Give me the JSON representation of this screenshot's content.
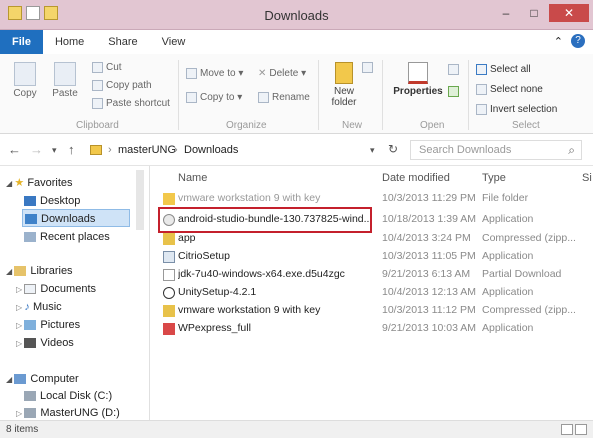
{
  "window": {
    "title": "Downloads",
    "controls": {
      "minimize": "–",
      "maximize": "□",
      "close": "✕"
    }
  },
  "ribbon_tabs": [
    "File",
    "Home",
    "Share",
    "View"
  ],
  "ribbon": {
    "clipboard": {
      "copy": "Copy",
      "paste": "Paste",
      "cut": "Cut",
      "copy_path": "Copy path",
      "paste_shortcut": "Paste shortcut",
      "group": "Clipboard"
    },
    "organize": {
      "move_to": "Move to ▾",
      "delete": "Delete ▾",
      "copy_to": "Copy to ▾",
      "rename": "Rename",
      "group": "Organize"
    },
    "new": {
      "new_folder": "New folder",
      "group": "New"
    },
    "open": {
      "properties": "Properties",
      "group": "Open"
    },
    "select": {
      "select_all": "Select all",
      "select_none": "Select none",
      "invert_selection": "Invert selection",
      "group": "Select"
    }
  },
  "address": {
    "crumbs": [
      "masterUNG",
      "Downloads"
    ],
    "search_placeholder": "Search Downloads"
  },
  "nav": {
    "favorites": "Favorites",
    "desktop": "Desktop",
    "downloads": "Downloads",
    "recent": "Recent places",
    "libraries": "Libraries",
    "documents": "Documents",
    "music": "Music",
    "pictures": "Pictures",
    "videos": "Videos",
    "computer": "Computer",
    "local_disk": "Local Disk (C:)",
    "masterung": "MasterUNG (D:)"
  },
  "columns": {
    "name": "Name",
    "date": "Date modified",
    "type": "Type",
    "size": "Si"
  },
  "files": [
    {
      "name": "vmware workstation 9 with key",
      "date": "10/3/2013 11:29 PM",
      "type": "File folder"
    },
    {
      "name": "android-studio-bundle-130.737825-wind...",
      "date": "10/18/2013 1:39 AM",
      "type": "Application"
    },
    {
      "name": "app",
      "date": "10/4/2013 3:24 PM",
      "type": "Compressed (zipp..."
    },
    {
      "name": "CitrioSetup",
      "date": "10/3/2013 11:05 PM",
      "type": "Application"
    },
    {
      "name": "jdk-7u40-windows-x64.exe.d5u4zgc",
      "date": "9/21/2013 6:13 AM",
      "type": "Partial Download"
    },
    {
      "name": "UnitySetup-4.2.1",
      "date": "10/4/2013 12:13 AM",
      "type": "Application"
    },
    {
      "name": "vmware workstation 9 with key",
      "date": "10/3/2013 11:12 PM",
      "type": "Compressed (zipp..."
    },
    {
      "name": "WPexpress_full",
      "date": "9/21/2013 10:03 AM",
      "type": "Application"
    }
  ],
  "status": {
    "items": "8 items"
  },
  "colors": {
    "file_tab": "#1f6fbf",
    "titlebar": "#e2c6d2",
    "highlight": "#c4202c",
    "selected": "#cfe3f7"
  }
}
